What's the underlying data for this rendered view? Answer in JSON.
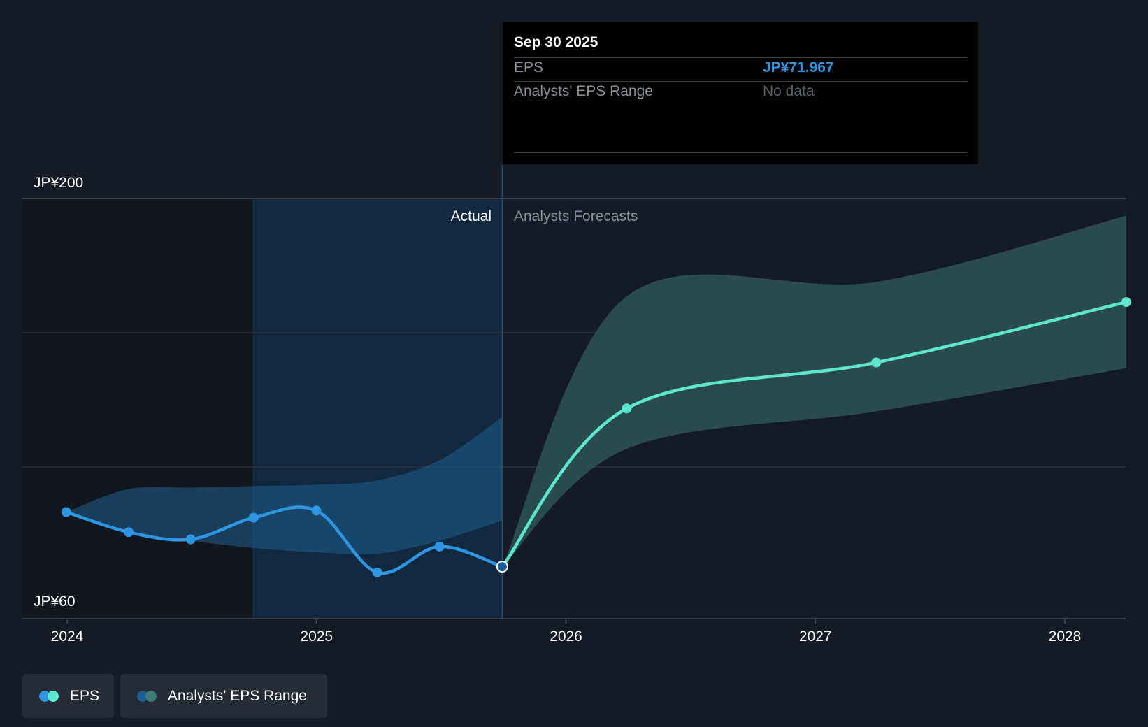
{
  "colors": {
    "background": "#151b24",
    "eps_actual": "#2e95e3",
    "eps_forecast": "#5ce6cf",
    "range_actual": "#1f5e8e",
    "range_forecast": "#2b4e4f",
    "tooltip_eps_value": "#2e95e3"
  },
  "tooltip": {
    "date": "Sep 30 2025",
    "eps_label": "EPS",
    "eps_value": "JP¥71.967",
    "range_label": "Analysts' EPS Range",
    "range_value": "No data"
  },
  "regions": {
    "actual_label": "Actual",
    "forecast_label": "Analysts Forecasts"
  },
  "legend": {
    "eps_label": "EPS",
    "range_label": "Analysts' EPS Range"
  },
  "chart_data": {
    "type": "line",
    "x_ticks": [
      "2024",
      "2025",
      "2026",
      "2027",
      "2028"
    ],
    "y_ticks": [
      "JP¥200",
      "JP¥60"
    ],
    "ylim": [
      60,
      200
    ],
    "grid": true,
    "series": [
      {
        "name": "EPS",
        "segment": "actual",
        "x": [
          "2023-12-31",
          "2024-03-31",
          "2024-06-30",
          "2024-09-30",
          "2024-12-31",
          "2025-03-31",
          "2025-06-30",
          "2025-09-30"
        ],
        "y": [
          91,
          84,
          81.5,
          89,
          91.5,
          70,
          79,
          72
        ]
      },
      {
        "name": "EPS",
        "segment": "forecast",
        "x": [
          "2025-09-30",
          "2026-03-31",
          "2027-03-31",
          "2028-03-31"
        ],
        "y": [
          72,
          127,
          143,
          164
        ]
      },
      {
        "name": "Analysts' EPS Range",
        "segment": "actual",
        "x": [
          "2023-12-31",
          "2024-03-31",
          "2024-06-30",
          "2024-09-30",
          "2024-12-31",
          "2025-03-31",
          "2025-06-30",
          "2025-09-30"
        ],
        "high": [
          91,
          99,
          99.5,
          100,
          100.5,
          102,
          109,
          124
        ],
        "low": [
          91,
          84,
          81,
          78.5,
          77,
          76.5,
          81,
          88
        ]
      },
      {
        "name": "Analysts' EPS Range",
        "segment": "forecast",
        "x": [
          "2025-09-30",
          "2026-03-31",
          "2027-03-31",
          "2028-03-31"
        ],
        "high": [
          72,
          166,
          171,
          194
        ],
        "low": [
          72,
          113,
          126,
          141
        ]
      }
    ]
  }
}
